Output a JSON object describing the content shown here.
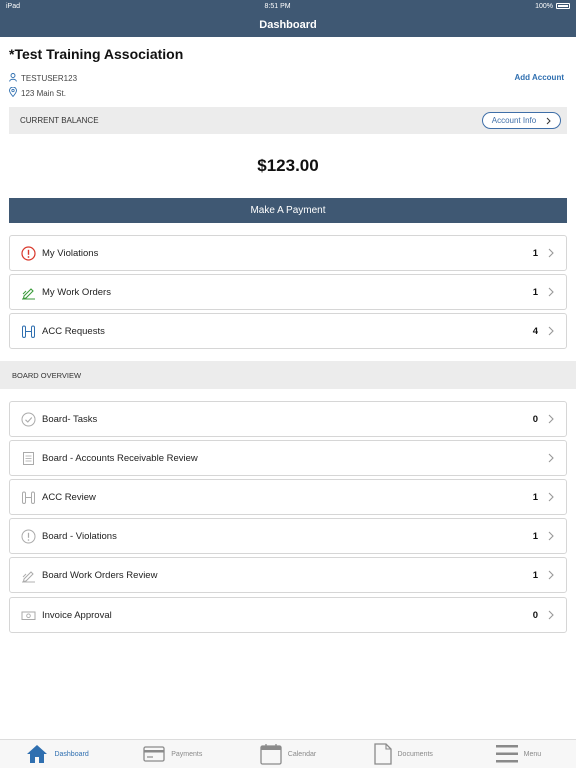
{
  "status_bar": {
    "device": "iPad",
    "time": "8:51 PM",
    "battery": "100%"
  },
  "nav": {
    "title": "Dashboard"
  },
  "association": {
    "name": "*Test Training Association",
    "user": "TESTUSER123",
    "address": "123 Main St.",
    "add_account_label": "Add Account"
  },
  "balance": {
    "label": "CURRENT BALANCE",
    "account_info_label": "Account Info",
    "amount": "$123.00",
    "pay_label": "Make A Payment"
  },
  "my_items": [
    {
      "label": "My Violations",
      "count": "1",
      "icon": "alert-circle-icon",
      "color": "#d9392c"
    },
    {
      "label": "My Work Orders",
      "count": "1",
      "icon": "pencil-ruler-icon",
      "color": "#3a9a3a"
    },
    {
      "label": "ACC Requests",
      "count": "4",
      "icon": "blueprint-icon",
      "color": "#2f6fb0"
    }
  ],
  "board_overview": {
    "header": "BOARD OVERVIEW",
    "items": [
      {
        "label": "Board- Tasks",
        "count": "0",
        "icon": "check-circle-icon"
      },
      {
        "label": "Board - Accounts Receivable Review",
        "count": "",
        "icon": "document-icon"
      },
      {
        "label": "ACC Review",
        "count": "1",
        "icon": "blueprint-icon"
      },
      {
        "label": "Board - Violations",
        "count": "1",
        "icon": "alert-circle-icon"
      },
      {
        "label": "Board Work Orders Review",
        "count": "1",
        "icon": "pencil-ruler-icon"
      },
      {
        "label": "Invoice Approval",
        "count": "0",
        "icon": "money-icon"
      }
    ]
  },
  "tabs": [
    {
      "label": "Dashboard",
      "icon": "home-icon",
      "active": true
    },
    {
      "label": "Payments",
      "icon": "credit-card-icon",
      "active": false
    },
    {
      "label": "Calendar",
      "icon": "calendar-icon",
      "active": false
    },
    {
      "label": "Documents",
      "icon": "document-icon",
      "active": false
    },
    {
      "label": "Menu",
      "icon": "hamburger-menu-icon",
      "active": false
    }
  ],
  "colors": {
    "brand": "#3f5873",
    "accent": "#2f6fb0",
    "muted": "#ececec"
  }
}
